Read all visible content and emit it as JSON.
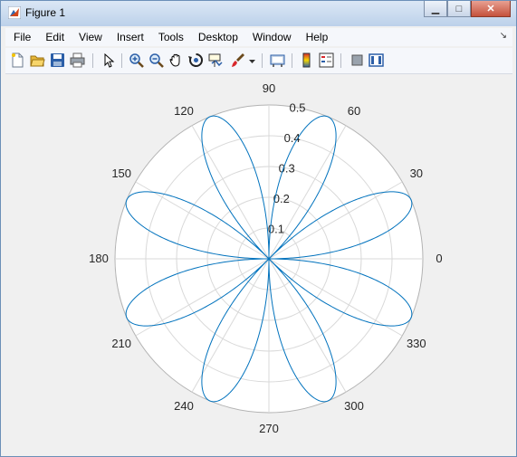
{
  "window": {
    "title": "Figure 1",
    "minimize_label": "▁",
    "maximize_label": "□",
    "close_label": "✕"
  },
  "menu": {
    "items": [
      "File",
      "Edit",
      "View",
      "Insert",
      "Tools",
      "Desktop",
      "Window",
      "Help"
    ]
  },
  "toolbar": {
    "icons": [
      "new-figure-icon",
      "open-file-icon",
      "save-icon",
      "print-icon",
      "select-arrow-icon",
      "zoom-in-icon",
      "zoom-out-icon",
      "pan-hand-icon",
      "rotate-3d-icon",
      "data-cursor-icon",
      "brush-icon",
      "brush-dropdown-icon",
      "link-plot-icon",
      "colorbar-icon",
      "legend-icon",
      "hide-plot-tools-icon",
      "show-plot-tools-icon"
    ]
  },
  "chart_data": {
    "type": "polar",
    "function": "r = 0.5*|sin(4θ)|",
    "series": [
      {
        "values": "petals of length 0.5 at 22.5°, 67.5°, 112.5°, 157.5°, 202.5°, 247.5°, 292.5°, 337.5°"
      }
    ],
    "rlim": [
      0,
      0.5
    ],
    "r_tick_labels": [
      "0.1",
      "0.2",
      "0.3",
      "0.4",
      "0.5"
    ],
    "theta_tick_labels": [
      "0",
      "30",
      "60",
      "90",
      "120",
      "150",
      "180",
      "210",
      "240",
      "270",
      "300",
      "330"
    ],
    "grid": true,
    "line_color": "#0072bd",
    "background_color": "#ffffff",
    "grid_color": "#d9d9d9"
  }
}
